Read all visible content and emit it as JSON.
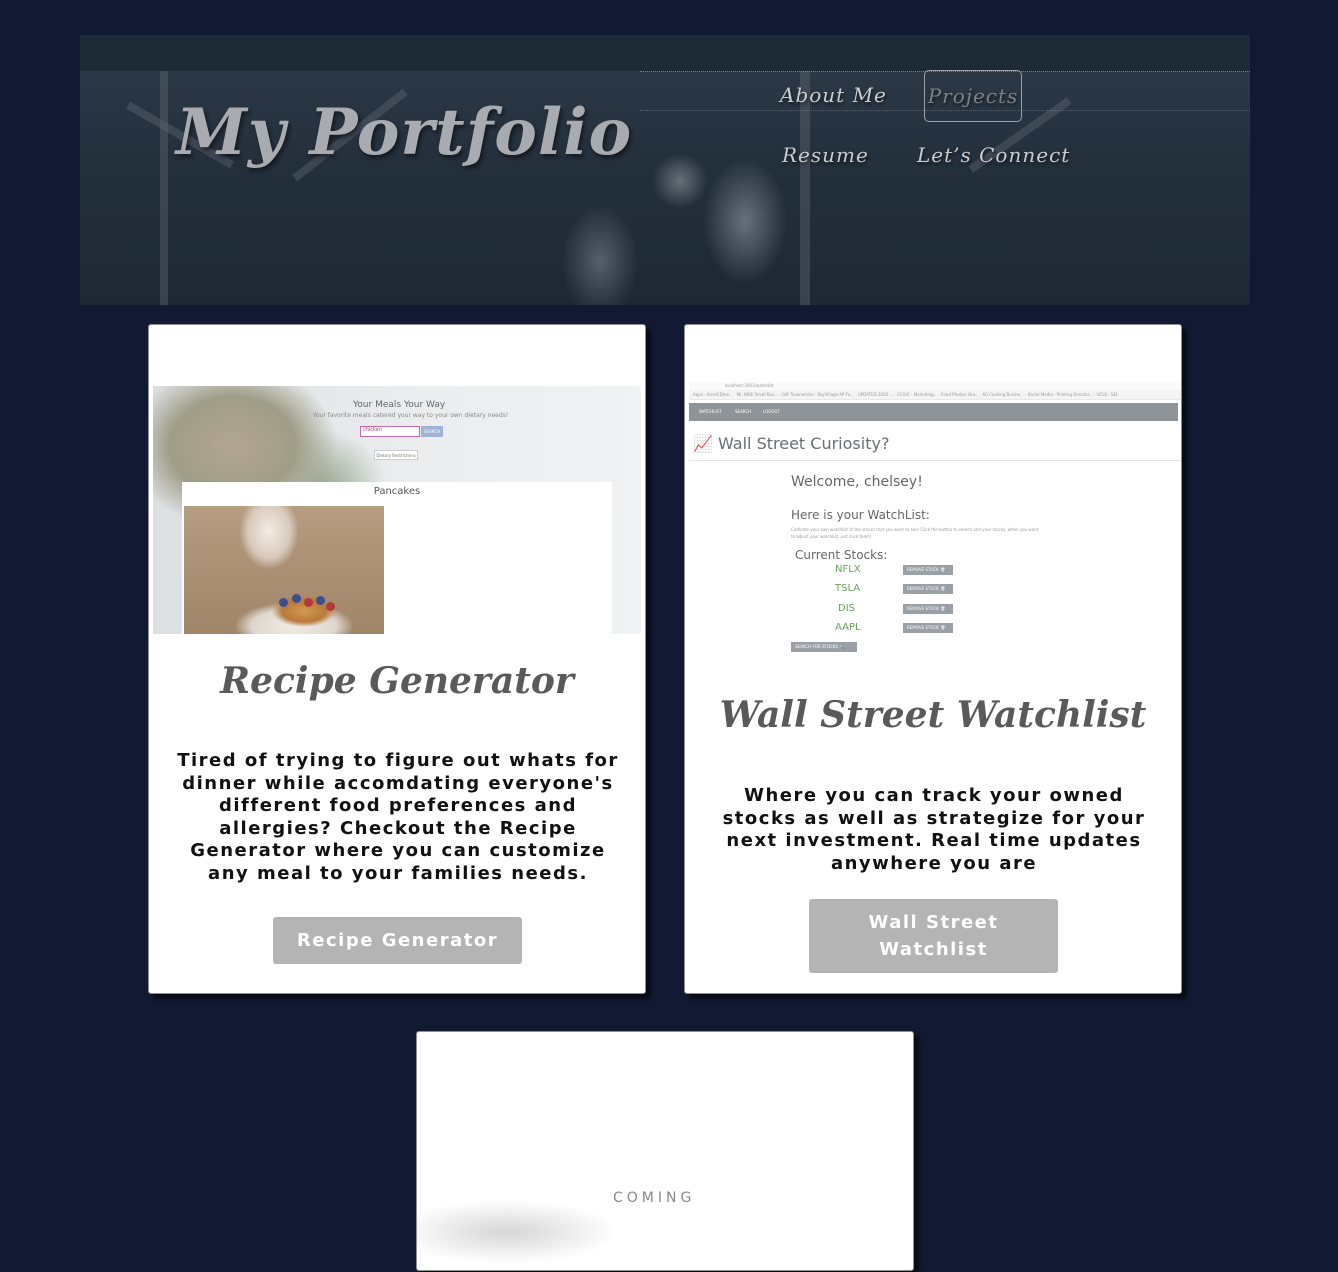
{
  "header": {
    "site_title": "My Portfolio",
    "nav": {
      "about": "About Me",
      "projects": "Projects",
      "resume": "Resume",
      "connect": "Let’s Connect"
    }
  },
  "projects": [
    {
      "title": "Recipe Generator",
      "description": "Tired of trying to figure out whats for dinner while accomdating everyone's different food preferences and allergies? Checkout the Recipe Generator where you can customize any meal to your families needs.",
      "button": "Recipe Generator",
      "screenshot": {
        "heading": "Your Meals Your Way",
        "subheading": "Your favorite meals catered your way to your own dietary needs!",
        "input_value": "chicken",
        "search_label": "SEARCH",
        "diet_label": "Dietary Restrictions",
        "result_title": "Pancakes"
      }
    },
    {
      "title": "Wall Street Watchlist",
      "description": "Where you can track your owned stocks as well as strategize for your next investment. Real time updates anywhere you are",
      "button": "Wall Street Watchlist",
      "screenshot": {
        "url": "localhost:3001/watchlist",
        "bookmarks": "Apps  ·  ArcelCDme...  ·  Mr. NIKE Small Bus...  ·  Gift Taxonomies  ·  SkyVillage AP Fo...  ·  UPDATED 2020 ...  ·  CC/UC - Marketing...  ·  Food Photos: Bra...  ·  60 Cooking Busine...  ·  Social Media  ·  Printing Director...  ·  UCLS  ·  SEL",
        "nav_items": [
          "WATCHLIST",
          "SEARCH",
          "LOGOUT"
        ],
        "heading": "📈 Wall Street Curiosity?",
        "welcome": "Welcome, chelsey!",
        "watchlist_heading": "Here is your WatchList:",
        "watchlist_note": "Cultivate your own watchlist of the stocks that you want to see! Click the button to search and your stocks, when you want to adjust your watchlist, just click them!",
        "current_label": "Current Stocks:",
        "tickers": [
          "NFLX",
          "TSLA",
          "DIS",
          "AAPL"
        ],
        "remove_label": "REMOVE STOCK 🗑",
        "search_button": "SEARCH FOR STOCKS 🔍"
      }
    },
    {
      "title": "",
      "teaser_text": "COMING"
    }
  ]
}
